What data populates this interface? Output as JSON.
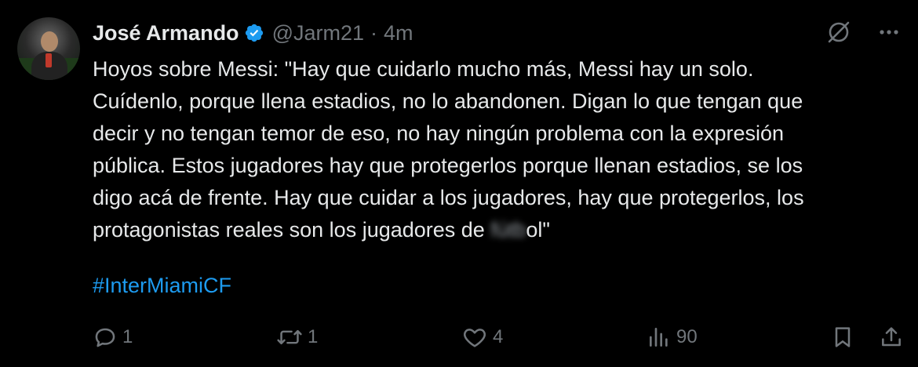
{
  "author": {
    "name": "José Armando",
    "handle": "@Jarm21",
    "separator": "·",
    "time": "4m"
  },
  "tweet": {
    "lines": [
      "Hoyos sobre Messi: \"Hay que cuidarlo mucho más, Messi hay un solo.",
      "Cuídenlo, porque llena estadios, no lo abandonen. Digan lo que tengan que",
      "decir y no tengan temor de eso, no hay ningún problema con la expresión",
      "pública. Estos jugadores hay que protegerlos porque llenan estadios, se los",
      "digo acá de frente. Hay que cuidar a los jugadores, hay que protegerlos, los"
    ],
    "last_line_start": "protagonistas reales son los jugadores de ",
    "last_line_blurred": "fútb",
    "last_line_end": "ol\"",
    "hashtag": "#InterMiamiCF"
  },
  "actions": {
    "reply_count": "1",
    "repost_count": "1",
    "like_count": "4",
    "views_count": "90"
  },
  "icons": {
    "verified": "verified-badge-icon",
    "grok": "grok-icon",
    "more": "more-icon",
    "reply": "reply-icon",
    "repost": "repost-icon",
    "like": "like-icon",
    "views": "views-icon",
    "bookmark": "bookmark-icon",
    "share": "share-icon"
  },
  "colors": {
    "background": "#000000",
    "text": "#e7e9ea",
    "muted": "#71767b",
    "link": "#1d9bf0",
    "verified": "#1d9bf0"
  }
}
